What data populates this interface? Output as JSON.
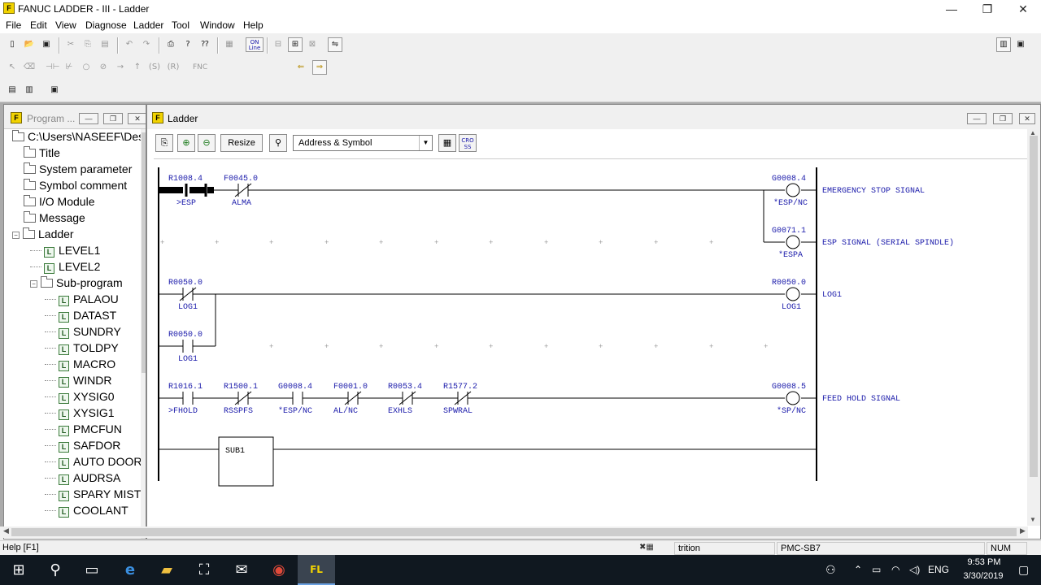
{
  "window": {
    "title": "FANUC LADDER - III - Ladder",
    "min": "—",
    "max": "❐",
    "close": "✕"
  },
  "menu": [
    "File",
    "Edit",
    "View",
    "Diagnose",
    "Ladder",
    "Tool",
    "Window",
    "Help"
  ],
  "toolbar": {
    "online_label": "ON Line",
    "fnc_label": "FNC"
  },
  "program_window": {
    "title": "Program ...",
    "path": "C:\\Users\\NASEEF\\Desk",
    "items": [
      {
        "label": "Title",
        "type": "folder",
        "indent": 1
      },
      {
        "label": "System parameter",
        "type": "folder",
        "indent": 1
      },
      {
        "label": "Symbol comment",
        "type": "folder",
        "indent": 1
      },
      {
        "label": "I/O Module",
        "type": "folder",
        "indent": 1
      },
      {
        "label": "Message",
        "type": "folder",
        "indent": 1
      },
      {
        "label": "Ladder",
        "type": "folder-open",
        "indent": 0
      },
      {
        "label": "LEVEL1",
        "type": "ladder",
        "indent": 2
      },
      {
        "label": "LEVEL2",
        "type": "ladder",
        "indent": 2
      },
      {
        "label": "Sub-program",
        "type": "folder-open",
        "indent": 2
      },
      {
        "label": "PALAOU",
        "type": "ladder",
        "indent": 3
      },
      {
        "label": "DATAST",
        "type": "ladder",
        "indent": 3
      },
      {
        "label": "SUNDRY",
        "type": "ladder",
        "indent": 3
      },
      {
        "label": "TOLDPY",
        "type": "ladder",
        "indent": 3
      },
      {
        "label": "MACRO",
        "type": "ladder",
        "indent": 3
      },
      {
        "label": "WINDR",
        "type": "ladder",
        "indent": 3
      },
      {
        "label": "XYSIG0",
        "type": "ladder",
        "indent": 3
      },
      {
        "label": "XYSIG1",
        "type": "ladder",
        "indent": 3
      },
      {
        "label": "PMCFUN",
        "type": "ladder",
        "indent": 3
      },
      {
        "label": "SAFDOR",
        "type": "ladder",
        "indent": 3
      },
      {
        "label": "AUTO DOOR",
        "type": "ladder",
        "indent": 3
      },
      {
        "label": "AUDRSA",
        "type": "ladder",
        "indent": 3
      },
      {
        "label": "SPARY MIST",
        "type": "ladder",
        "indent": 3
      },
      {
        "label": "COOLANT",
        "type": "ladder",
        "indent": 3
      }
    ]
  },
  "ladder_window": {
    "title": "Ladder",
    "resize_label": "Resize",
    "display_mode": "Address & Symbol",
    "cross_label": "CRO SS"
  },
  "ladder": {
    "rung1": {
      "contacts": [
        {
          "addr": "R1008.4",
          "sym": ">ESP",
          "type": "no",
          "active": true
        },
        {
          "addr": "F0045.0",
          "sym": "ALMA",
          "type": "nc"
        }
      ],
      "coils": [
        {
          "addr": "G0008.4",
          "sym": "*ESP/NC",
          "comment": "EMERGENCY STOP SIGNAL"
        },
        {
          "addr": "G0071.1",
          "sym": "*ESPA",
          "comment": "ESP SIGNAL (SERIAL SPINDLE)"
        }
      ]
    },
    "rung2": {
      "contacts": [
        {
          "addr": "R0050.0",
          "sym": "LOG1",
          "type": "nc"
        },
        {
          "addr": "R0050.0",
          "sym": "LOG1",
          "type": "no"
        }
      ],
      "coil": {
        "addr": "R0050.0",
        "sym": "LOG1",
        "comment": "LOG1"
      }
    },
    "rung3": {
      "contacts": [
        {
          "addr": "R1016.1",
          "sym": ">FHOLD",
          "type": "no"
        },
        {
          "addr": "R1500.1",
          "sym": "RSSPFS",
          "type": "nc"
        },
        {
          "addr": "G0008.4",
          "sym": "*ESP/NC",
          "type": "no"
        },
        {
          "addr": "F0001.0",
          "sym": "AL/NC",
          "type": "nc"
        },
        {
          "addr": "R0053.4",
          "sym": "EXHLS",
          "type": "nc"
        },
        {
          "addr": "R1577.2",
          "sym": "SPWRAL",
          "type": "nc"
        }
      ],
      "coil": {
        "addr": "G0008.5",
        "sym": "*SP/NC",
        "comment": "FEED HOLD SIGNAL"
      }
    },
    "rung4": {
      "block": "SUB1"
    }
  },
  "statusbar": {
    "help": "Help [F1]",
    "field": "trition",
    "pmc": "PMC-SB7",
    "num": "NUM"
  },
  "taskbar": {
    "lang": "ENG",
    "time": "9:53 PM",
    "date": "3/30/2019"
  },
  "colors": {
    "address_text": "#1a1aaa",
    "ladder_line": "#000000",
    "comment_text": "#1a1aaa"
  }
}
